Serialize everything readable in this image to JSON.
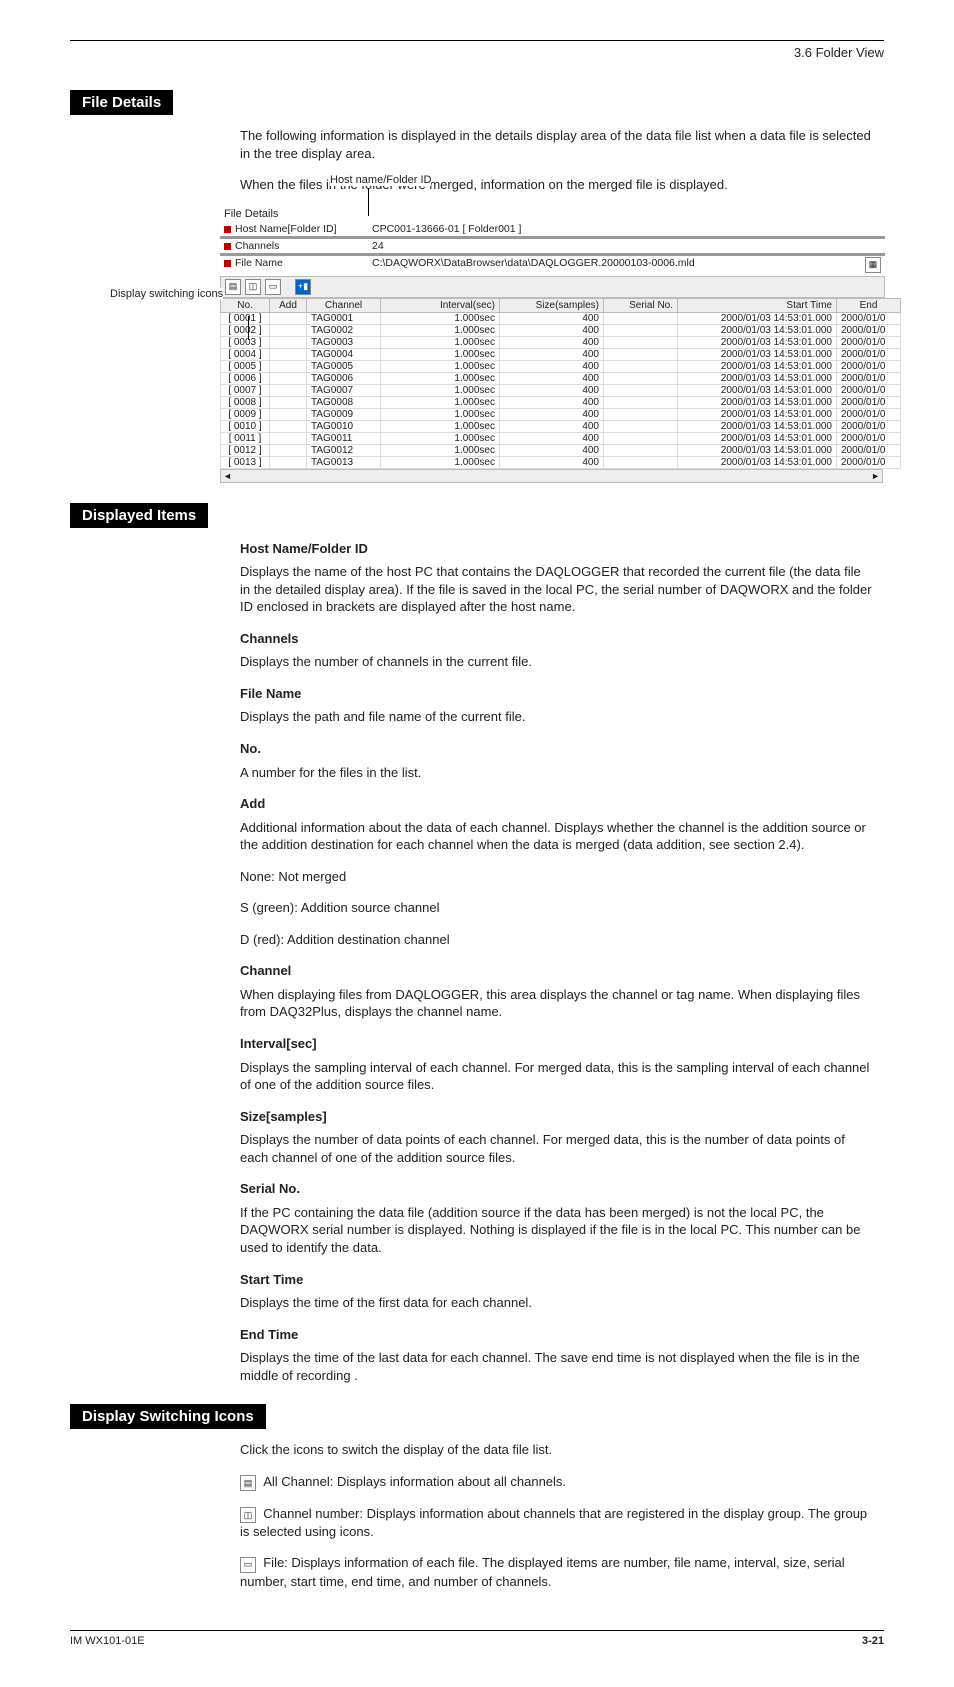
{
  "header": {
    "right": "3.6 Folder View"
  },
  "section_title": "File Details",
  "intro1": "The following information is displayed in the details display area of the data file list when a data file is selected in the tree display area.",
  "intro2": "When the files in the folder were merged, information on the merged file is displayed.",
  "callouts": {
    "host": "Host name/Folder ID",
    "icons": "Display switching icons"
  },
  "filedetails": {
    "title": "File Details",
    "rows": [
      {
        "label": "Host Name[Folder ID]",
        "value": "CPC001-13666-01 [ Folder001 ]"
      },
      {
        "label": "Channels",
        "value": "24"
      },
      {
        "label": "File Name",
        "value": "C:\\DAQWORX\\DataBrowser\\data\\DAQLOGGER.20000103-0006.mld"
      }
    ]
  },
  "grid": {
    "headers": [
      "No.",
      "Add",
      "Channel",
      "Interval(sec)",
      "Size(samples)",
      "Serial No.",
      "Start Time",
      "End"
    ],
    "rows": [
      {
        "no": "[ 0001 ]",
        "add": "",
        "ch": "TAG0001",
        "int": "1.000sec",
        "size": "400",
        "ser": "",
        "st": "2000/01/03 14:53:01.000",
        "end": "2000/01/0"
      },
      {
        "no": "[ 0002 ]",
        "add": "",
        "ch": "TAG0002",
        "int": "1.000sec",
        "size": "400",
        "ser": "",
        "st": "2000/01/03 14:53:01.000",
        "end": "2000/01/0"
      },
      {
        "no": "[ 0003 ]",
        "add": "",
        "ch": "TAG0003",
        "int": "1.000sec",
        "size": "400",
        "ser": "",
        "st": "2000/01/03 14:53:01.000",
        "end": "2000/01/0"
      },
      {
        "no": "[ 0004 ]",
        "add": "",
        "ch": "TAG0004",
        "int": "1.000sec",
        "size": "400",
        "ser": "",
        "st": "2000/01/03 14:53:01.000",
        "end": "2000/01/0"
      },
      {
        "no": "[ 0005 ]",
        "add": "",
        "ch": "TAG0005",
        "int": "1.000sec",
        "size": "400",
        "ser": "",
        "st": "2000/01/03 14:53:01.000",
        "end": "2000/01/0"
      },
      {
        "no": "[ 0006 ]",
        "add": "",
        "ch": "TAG0006",
        "int": "1.000sec",
        "size": "400",
        "ser": "",
        "st": "2000/01/03 14:53:01.000",
        "end": "2000/01/0"
      },
      {
        "no": "[ 0007 ]",
        "add": "",
        "ch": "TAG0007",
        "int": "1.000sec",
        "size": "400",
        "ser": "",
        "st": "2000/01/03 14:53:01.000",
        "end": "2000/01/0"
      },
      {
        "no": "[ 0008 ]",
        "add": "",
        "ch": "TAG0008",
        "int": "1.000sec",
        "size": "400",
        "ser": "",
        "st": "2000/01/03 14:53:01.000",
        "end": "2000/01/0"
      },
      {
        "no": "[ 0009 ]",
        "add": "",
        "ch": "TAG0009",
        "int": "1.000sec",
        "size": "400",
        "ser": "",
        "st": "2000/01/03 14:53:01.000",
        "end": "2000/01/0"
      },
      {
        "no": "[ 0010 ]",
        "add": "",
        "ch": "TAG0010",
        "int": "1.000sec",
        "size": "400",
        "ser": "",
        "st": "2000/01/03 14:53:01.000",
        "end": "2000/01/0"
      },
      {
        "no": "[ 0011 ]",
        "add": "",
        "ch": "TAG0011",
        "int": "1.000sec",
        "size": "400",
        "ser": "",
        "st": "2000/01/03 14:53:01.000",
        "end": "2000/01/0"
      },
      {
        "no": "[ 0012 ]",
        "add": "",
        "ch": "TAG0012",
        "int": "1.000sec",
        "size": "400",
        "ser": "",
        "st": "2000/01/03 14:53:01.000",
        "end": "2000/01/0"
      },
      {
        "no": "[ 0013 ]",
        "add": "",
        "ch": "TAG0013",
        "int": "1.000sec",
        "size": "400",
        "ser": "",
        "st": "2000/01/03 14:53:01.000",
        "end": "2000/01/0"
      }
    ]
  },
  "section2_title": "Displayed Items",
  "desc": {
    "host_label": "Host Name/Folder ID",
    "host_text": "Displays the name of the host PC that contains the DAQLOGGER that recorded the current file (the data file in the detailed display area). If the file is saved in the local PC, the serial number of DAQWORX and the folder ID enclosed in brackets are displayed after the host name.",
    "channels_label": "Channels",
    "channels_text": "Displays the number of channels in the current file.",
    "filename_label": "File Name",
    "filename_text": "Displays the path and file name of the current file.",
    "no_label": "No.",
    "no_text": "A number for the files in the list.",
    "add_label": "Add",
    "add_text": "Additional information about the data of each channel. Displays whether the channel is the addition source or the addition destination for each channel when the data is merged (data addition, see section 2.4).",
    "add_none_k": "None:",
    "add_none_v": "Not merged",
    "add_s_k": "S (green):",
    "add_s_v": "Addition source channel",
    "add_d_k": "D (red):",
    "add_d_v": "Addition destination channel",
    "channel_label": "Channel",
    "channel_text": "When displaying files from DAQLOGGER, this area displays the channel or tag name. When displaying files from DAQ32Plus, displays the channel name.",
    "interval_label": "Interval[sec]",
    "interval_text": "Displays the sampling interval of each channel. For merged data, this is the sampling interval of each channel of one of the addition source files.",
    "size_label": "Size[samples]",
    "size_text": "Displays the number of data points of each channel. For merged data, this is the number of data points of each channel of one of the addition source files.",
    "serial_label": "Serial No.",
    "serial_text": "If the PC containing the data file (addition source if the data has been merged) is not the local PC, the DAQWORX serial number is displayed. Nothing is displayed if the file is in the local PC. This number can be used to identify the data.",
    "starttime_label": "Start Time",
    "starttime_text": "Displays the time of the first data for each channel.",
    "endtime_label": "End Time",
    "endtime_text": "Displays the time of the last data for each channel. The save end time is not displayed when the file is in the middle of recording ."
  },
  "section3_title": "Display Switching Icons",
  "icons_intro": "Click the icons to switch the display of the data file list.",
  "icons": [
    {
      "label": "All Channel:",
      "text": "Displays information about all channels."
    },
    {
      "label": "Channel number:",
      "text": "Displays information about channels that are registered in the display group. The group is selected using icons."
    },
    {
      "label": "File:",
      "text": "Displays information of each file. The displayed items are number, file name, interval, size, serial number, start time, end time, and number of channels."
    }
  ],
  "footer": {
    "left": "IM WX101-01E",
    "right": "3-21"
  }
}
